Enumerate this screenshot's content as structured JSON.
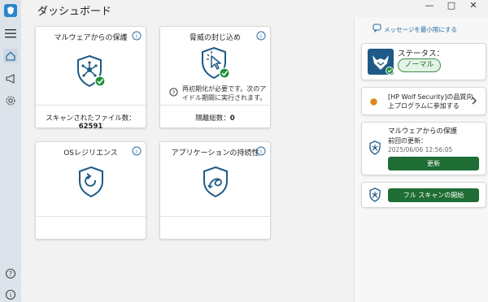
{
  "window": {
    "title": "ダッシュボード",
    "controls": {
      "minimize": "—",
      "maximize": "□",
      "close": "✕"
    }
  },
  "nav": {
    "items": [
      {
        "icon": "home-icon",
        "selected": true
      },
      {
        "icon": "megaphone-icon",
        "selected": false
      },
      {
        "icon": "gear-icon",
        "selected": false
      }
    ],
    "bottom": [
      {
        "icon": "help-icon"
      },
      {
        "icon": "info-icon"
      }
    ]
  },
  "cards": {
    "malware": {
      "title": "マルウェアからの保護",
      "footer_label": "スキャンされたファイル数：",
      "footer_value": "62591"
    },
    "threat": {
      "title": "脅威の封じ込め",
      "note_line1": "再初期化が必要です。次のア",
      "note_line2": "イドル期間に実行されます。",
      "footer_label": "隔離総数：",
      "footer_value": "0"
    },
    "os": {
      "title": "OSレジリエンス"
    },
    "app": {
      "title": "アプリケーションの持続性"
    }
  },
  "panel": {
    "minimize_messages": "メッセージを最小限にする",
    "status_label": "ステータス：",
    "status_value": "ノーマル",
    "program_line1": "[HP Wolf Security]の品質向",
    "program_line2": "上プログラムに参加する",
    "protection_title": "マルウェアからの保護",
    "last_update_label": "前回の更新：",
    "last_update_value": "2025/06/06 12:56:05",
    "update_button": "更新",
    "full_scan_button": "フル スキャンの開始"
  },
  "colors": {
    "accent_blue": "#1e5a86",
    "check_green": "#1f8f3a",
    "button_green": "#1f6e35",
    "program_dot": "#d98a1c"
  }
}
